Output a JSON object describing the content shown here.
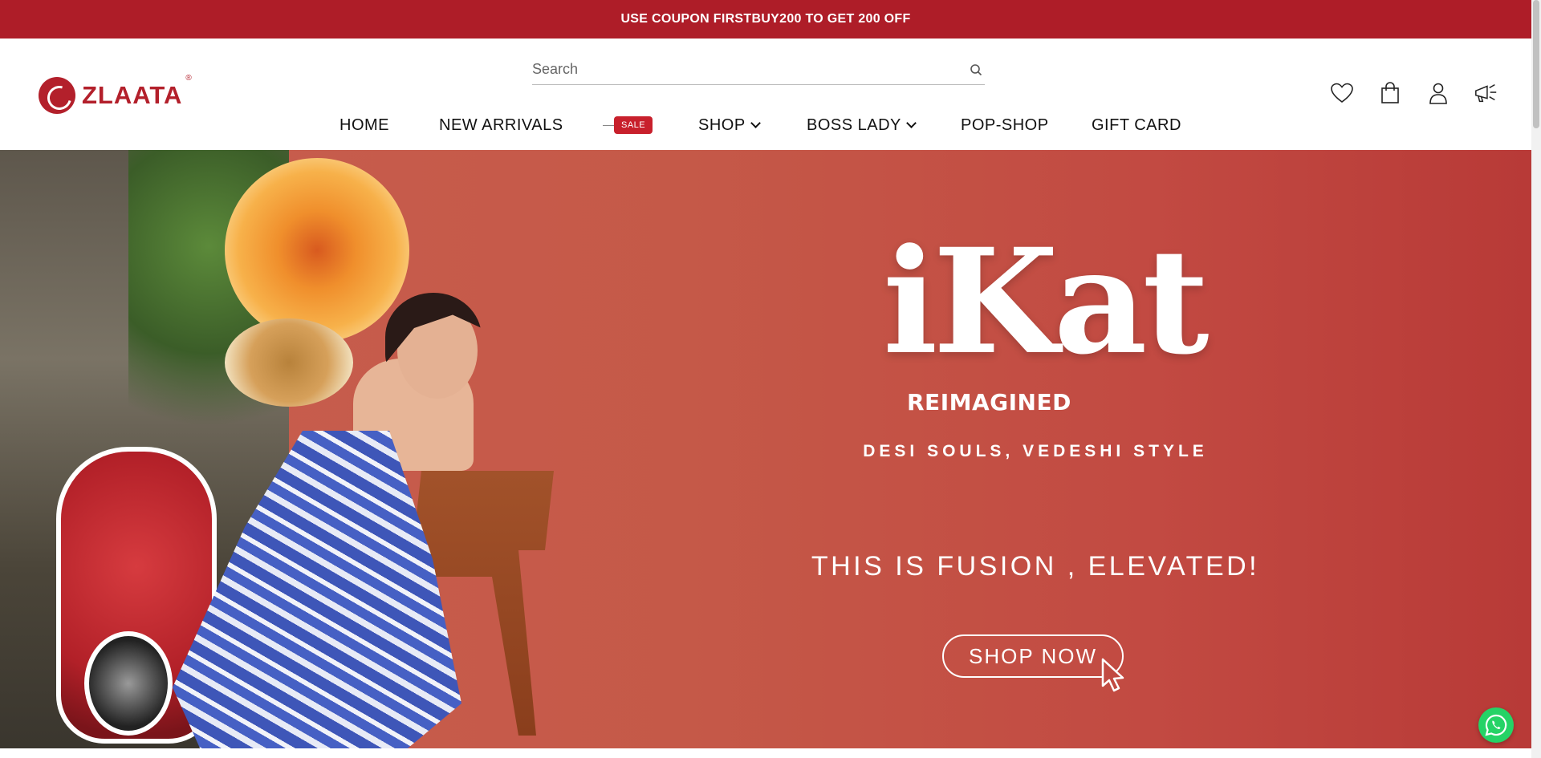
{
  "announcement": {
    "text": "USE COUPON FIRSTBUY200 TO GET 200 OFF"
  },
  "brand": {
    "name": "ZLAATA",
    "reg": "®",
    "color": "#b3202b"
  },
  "search": {
    "placeholder": "Search"
  },
  "nav": {
    "items": [
      {
        "label": "HOME"
      },
      {
        "label": "NEW ARRIVALS"
      },
      {
        "label": "SALE"
      },
      {
        "label": "SHOP"
      },
      {
        "label": "BOSS LADY"
      },
      {
        "label": "POP-SHOP"
      },
      {
        "label": "GIFT CARD"
      }
    ]
  },
  "header_icons": [
    "heart-icon",
    "shopping-bag-icon",
    "user-icon",
    "megaphone-icon"
  ],
  "hero": {
    "logo_word": "iKat",
    "logo_sub": "REIMAGINED",
    "tagline": "DESI SOULS, VEDESHI STYLE",
    "headline": "THIS IS FUSION , ELEVATED!",
    "cta": "SHOP NOW",
    "bg_color": "#c55948"
  },
  "colors": {
    "announce_bg": "#ae1d28",
    "sale_tag": "#c8202c",
    "whatsapp": "#25d366"
  }
}
